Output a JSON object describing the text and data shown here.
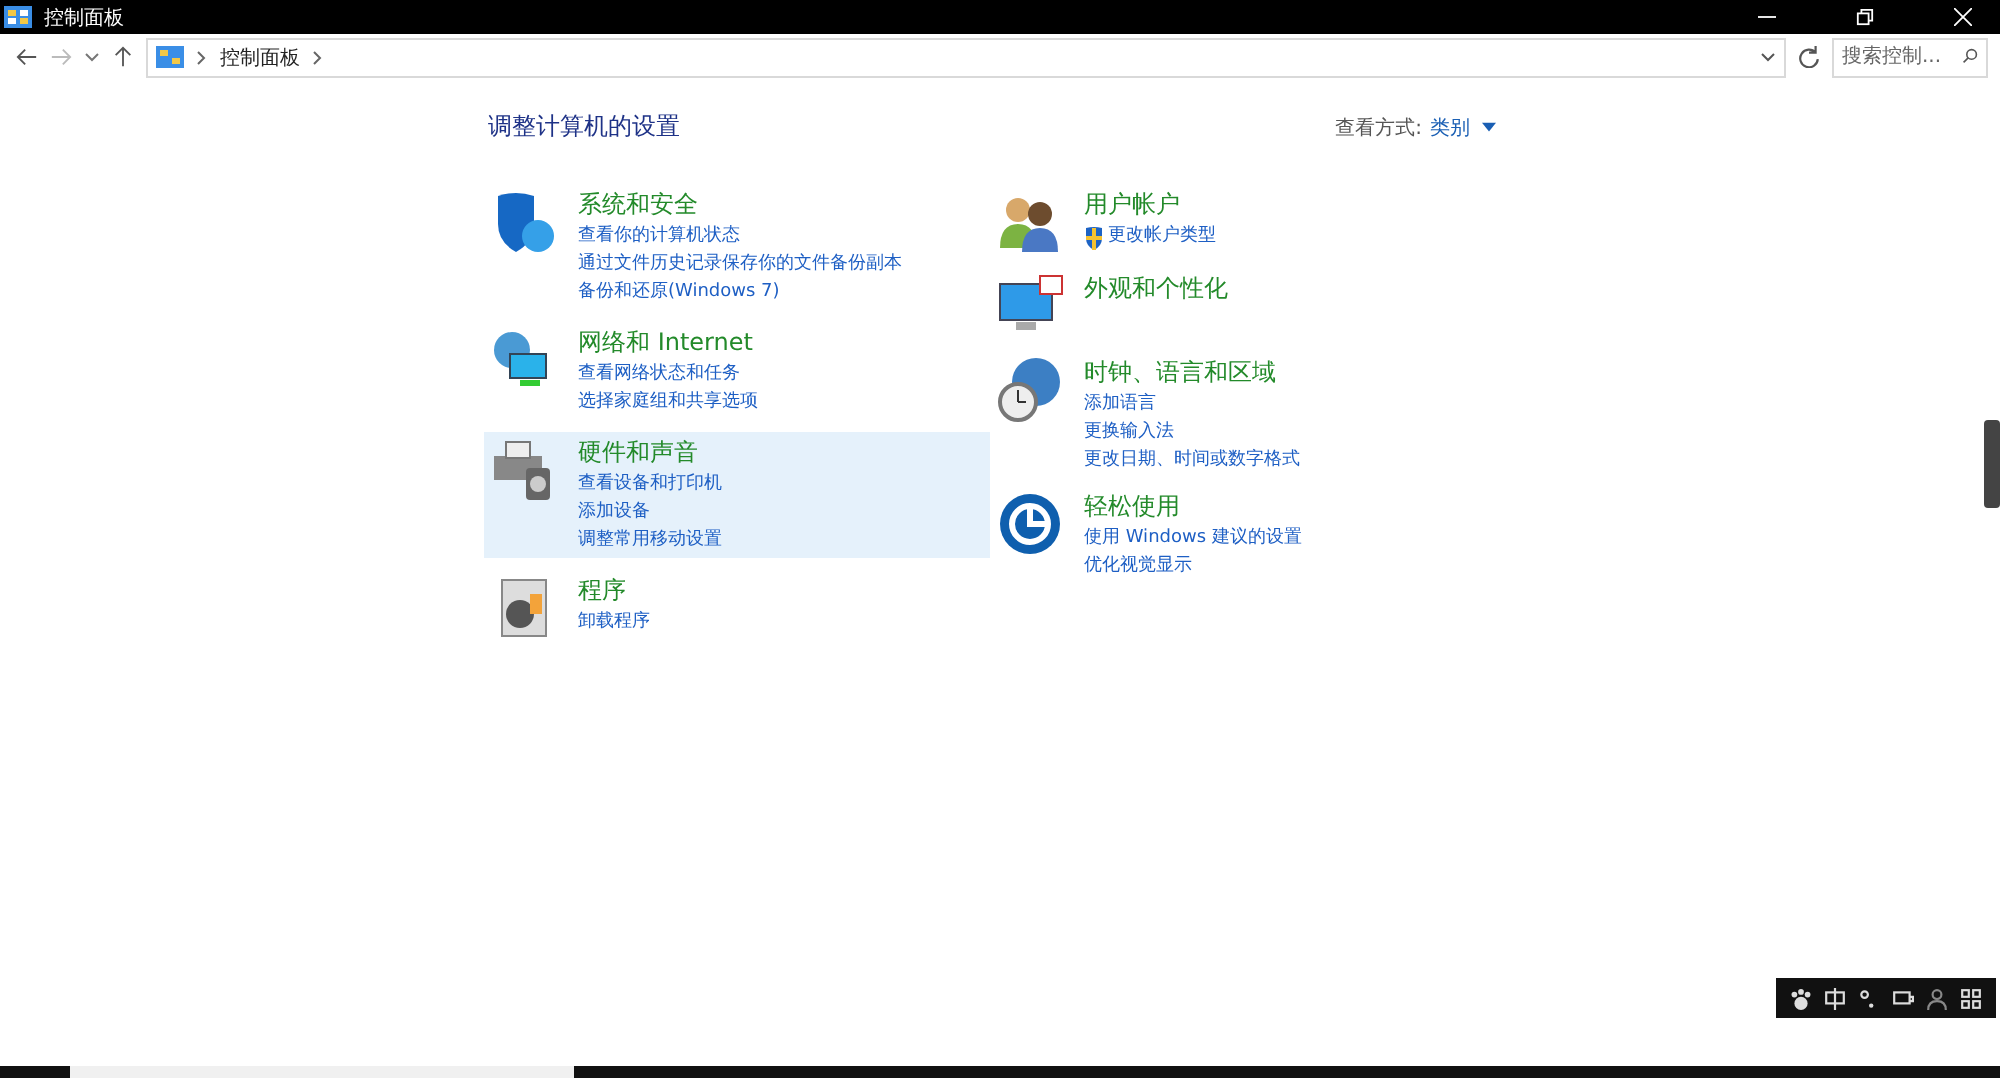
{
  "window": {
    "title": "控制面板"
  },
  "address_bar": {
    "path": [
      "控制面板"
    ]
  },
  "search": {
    "placeholder": "搜索控制..."
  },
  "heading": "调整计算机的设置",
  "view_by": {
    "label": "查看方式:",
    "value": "类别"
  },
  "columns": [
    [
      {
        "kind": "security",
        "title": "系统和安全",
        "highlighted": false,
        "links": [
          {
            "text": "查看你的计算机状态",
            "shield": false
          },
          {
            "text": "通过文件历史记录保存你的文件备份副本",
            "shield": false
          },
          {
            "text": "备份和还原(Windows 7)",
            "shield": false
          }
        ]
      },
      {
        "kind": "network",
        "title": "网络和 Internet",
        "highlighted": false,
        "links": [
          {
            "text": "查看网络状态和任务",
            "shield": false
          },
          {
            "text": "选择家庭组和共享选项",
            "shield": false
          }
        ]
      },
      {
        "kind": "hardware",
        "title": "硬件和声音",
        "highlighted": true,
        "links": [
          {
            "text": "查看设备和打印机",
            "shield": false
          },
          {
            "text": "添加设备",
            "shield": false
          },
          {
            "text": "调整常用移动设置",
            "shield": false
          }
        ]
      },
      {
        "kind": "programs",
        "title": "程序",
        "highlighted": false,
        "links": [
          {
            "text": "卸载程序",
            "shield": false
          }
        ]
      }
    ],
    [
      {
        "kind": "users",
        "title": "用户帐户",
        "highlighted": false,
        "links": [
          {
            "text": "更改帐户类型",
            "shield": true
          }
        ]
      },
      {
        "kind": "appearance",
        "title": "外观和个性化",
        "highlighted": false
      },
      {
        "kind": "clock",
        "title": "时钟、语言和区域",
        "highlighted": false,
        "links": [
          {
            "text": "添加语言",
            "shield": false
          },
          {
            "text": "更换输入法",
            "shield": false
          },
          {
            "text": "更改日期、时间或数字格式",
            "shield": false
          }
        ]
      },
      {
        "kind": "ease",
        "title": "轻松使用",
        "highlighted": false,
        "links": [
          {
            "text": "使用 Windows 建议的设置",
            "shield": false
          },
          {
            "text": "优化视觉显示",
            "shield": false
          }
        ]
      }
    ]
  ]
}
